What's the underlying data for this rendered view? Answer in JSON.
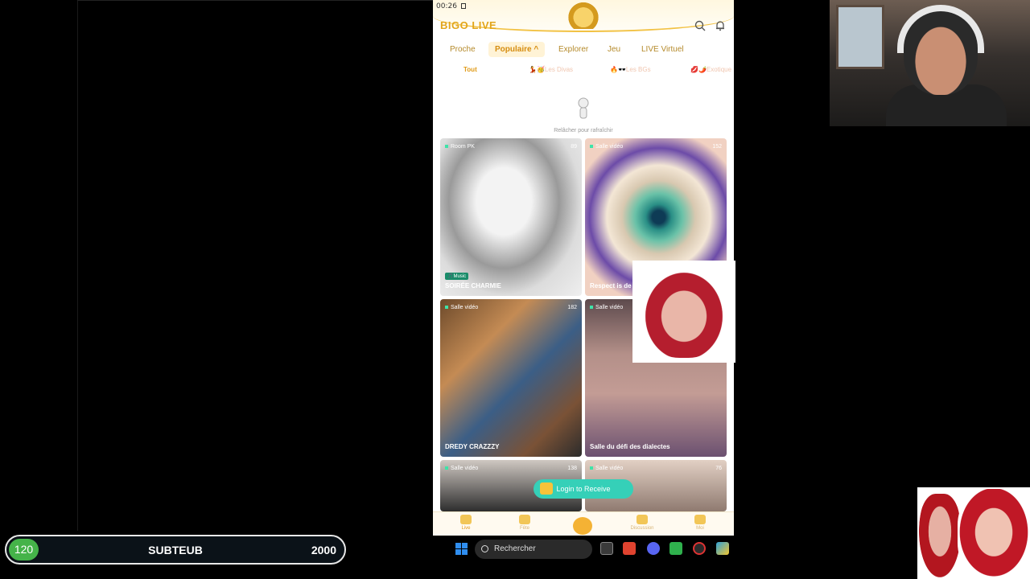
{
  "phone": {
    "status_time": "00:26",
    "brand": "BIGO LIVE",
    "tabs": [
      {
        "label": "Proche"
      },
      {
        "label": "Populaire ^"
      },
      {
        "label": "Explorer"
      },
      {
        "label": "Jeu"
      },
      {
        "label": "LIVE Virtuel"
      }
    ],
    "subtabs": [
      "Tout",
      "💃🥳Les Divas",
      "🔥🕶️Les BGs",
      "💋🌶️Exotique"
    ],
    "refresh_text": "Relâcher pour rafraîchir",
    "cards": [
      {
        "tag": "Room PK",
        "count": "89",
        "music": "🎵Music",
        "name": "SOIRÉE CHARMIE"
      },
      {
        "tag": "Salle vidéo",
        "count": "152",
        "name": "Respect is de"
      },
      {
        "tag": "Salle vidéo",
        "count": "182",
        "name": "DREDY CRAZZZY"
      },
      {
        "tag": "Salle vidéo",
        "count": "",
        "name": "Salle du défi des dialectes"
      },
      {
        "tag": "Salle vidéo",
        "count": "138",
        "name": ""
      },
      {
        "tag": "Salle vidéo",
        "count": "76",
        "name": ""
      }
    ],
    "login_button": "Login to Receive",
    "bottom_nav": [
      "Live",
      "Fête",
      "",
      "Discussion",
      "Moi"
    ]
  },
  "score_bar": {
    "level": "120",
    "name": "SUBTEUB",
    "goal": "2000"
  },
  "taskbar": {
    "search_label": "Rechercher",
    "accent": "#2f8ef0"
  }
}
